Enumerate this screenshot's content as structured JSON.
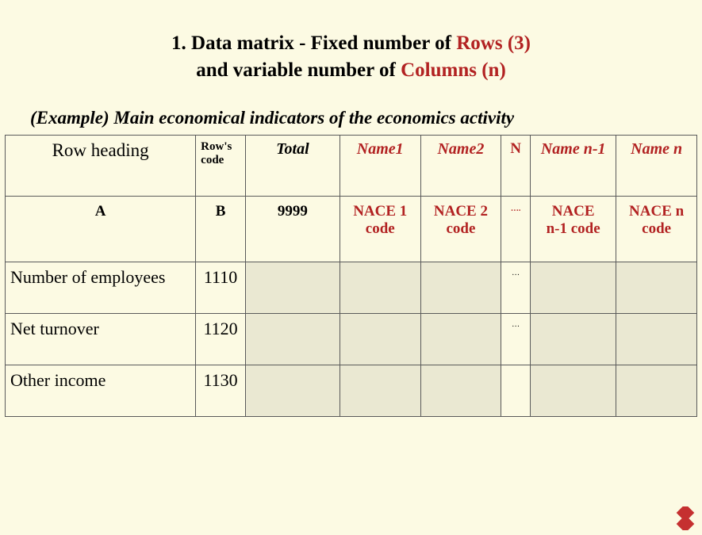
{
  "title": {
    "line1_prefix": "1. Data matrix - Fixed number of ",
    "line1_emph": "Rows (3)",
    "line2_prefix": "and variable number of ",
    "line2_emph": "Columns (n)"
  },
  "subtitle": "(Example) Main economical indicators of the economics activity",
  "headers": {
    "row_heading": "Row heading",
    "rows_code": "Row's code",
    "total": "Total",
    "name1": "Name1",
    "name2": "Name2",
    "n": "N",
    "name_n_minus_1": "Name n-1",
    "name_n": "Name n"
  },
  "row2": {
    "a": "A",
    "b": "B",
    "total_code": "9999",
    "nace1": "NACE 1 code",
    "nace2": "NACE 2 code",
    "dots": "….",
    "nace_nm1_line1": "NACE",
    "nace_nm1_line2": "n-1 code",
    "nace_n": "NACE n code"
  },
  "chart_data": {
    "type": "table",
    "title": "Main economical indicators of the economics activity",
    "columns": [
      "Row heading",
      "Row's code",
      "Total",
      "Name1",
      "Name2",
      "…",
      "Name n-1",
      "Name n"
    ],
    "column_codes_row": [
      "A",
      "B",
      "9999",
      "NACE 1 code",
      "NACE 2 code",
      "….",
      "NACE n-1 code",
      "NACE n code"
    ],
    "rows": [
      {
        "label": "Number of employees",
        "code": "1110",
        "total": null,
        "name1": null,
        "name2": null,
        "dots": "…",
        "name_n_minus_1": null,
        "name_n": null
      },
      {
        "label": "Net turnover",
        "code": "1120",
        "total": null,
        "name1": null,
        "name2": null,
        "dots": "…",
        "name_n_minus_1": null,
        "name_n": null
      },
      {
        "label": "Other income",
        "code": "1130",
        "total": null,
        "name1": null,
        "name2": null,
        "dots": "",
        "name_n_minus_1": null,
        "name_n": null
      }
    ]
  }
}
